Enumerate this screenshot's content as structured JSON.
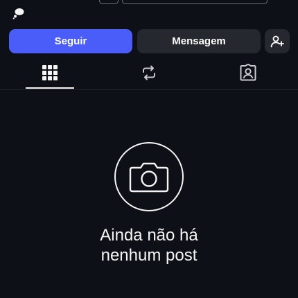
{
  "profile": {
    "follow_label": "Seguir",
    "message_label": "Mensagem"
  },
  "tabs": [
    {
      "name": "posts-grid",
      "icon": "grid-icon",
      "active": true
    },
    {
      "name": "reels",
      "icon": "repost-icon",
      "active": false
    },
    {
      "name": "tagged",
      "icon": "tagged-person-icon",
      "active": false
    }
  ],
  "empty_state": {
    "icon": "camera-icon",
    "text": "Ainda não há nenhum post"
  },
  "colors": {
    "background": "#0d1117",
    "accent": "#4a5df9",
    "secondary_button": "#25292f",
    "text": "#f5f5f5"
  }
}
